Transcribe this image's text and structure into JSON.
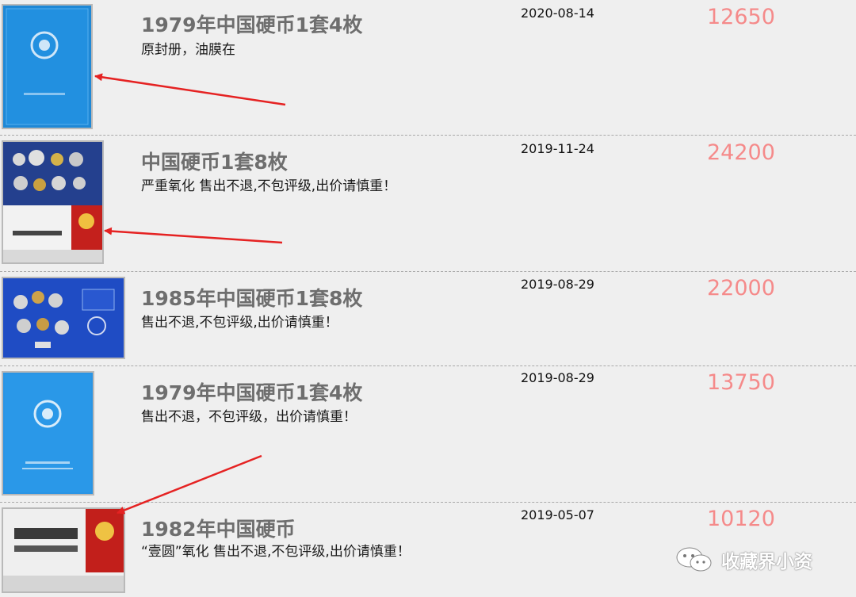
{
  "listings": [
    {
      "title": "1979年中国硬币1套4枚",
      "desc": "原封册，油膜在",
      "date": "2020-08-14",
      "price": "12650",
      "image": "blue-album-emblem"
    },
    {
      "title": "中国硬币1套8枚",
      "desc": "严重氧化 售出不退,不包评级,出价请慎重！",
      "date": "2019-11-24",
      "price": "24200",
      "image": "coin-set-card-china-coins"
    },
    {
      "title": "1985年中国硬币1套8枚",
      "desc": "售出不退,不包评级,出价请慎重！",
      "date": "2019-08-29",
      "price": "22000",
      "image": "blue-coin-set-card"
    },
    {
      "title": "1979年中国硬币1套4枚",
      "desc": "售出不退，不包评级，出价请慎重！",
      "date": "2019-08-29",
      "price": "13750",
      "image": "blue-album-emblem"
    },
    {
      "title": "1982年中国硬币",
      "desc": "“壹圆”氧化 售出不退,不包评级,出价请慎重！",
      "date": "2019-05-07",
      "price": "10120",
      "image": "china-coins-cover"
    }
  ],
  "watermark": {
    "text": "收藏界小资",
    "icon": "wechat-icon"
  },
  "colors": {
    "price": "#f58a8a",
    "title": "#6e6e6e",
    "arrow": "#e52222",
    "background": "#efefef"
  }
}
